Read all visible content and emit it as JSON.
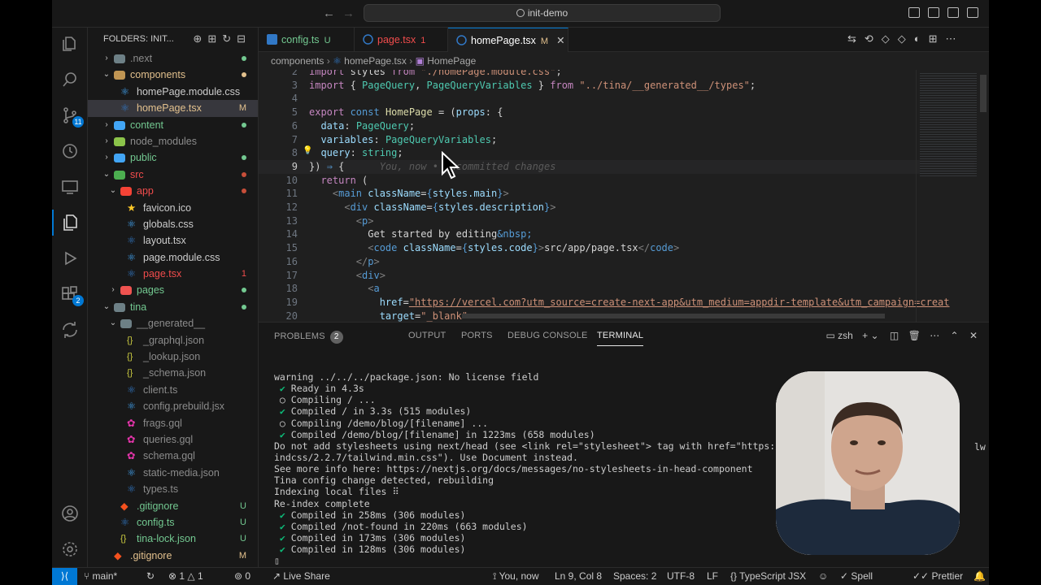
{
  "titlebar": {
    "search_text": "init-demo"
  },
  "sidebar": {
    "header": "FOLDERS: INIT...",
    "tree": [
      {
        "label": ".next",
        "depth": 1,
        "chev": "closed",
        "kind": "folder",
        "icon_color": "#6d8086",
        "label_color": "#8b8b8b",
        "status": "",
        "dot": "#73c991"
      },
      {
        "label": "components",
        "depth": 1,
        "chev": "open",
        "kind": "folder",
        "icon_color": "#c09553",
        "label_color": "#e2c08d",
        "status": "",
        "dot": "#e2c08d"
      },
      {
        "label": "homePage.module.css",
        "depth": 2,
        "chev": "",
        "kind": "file",
        "icon_color": "#42a5f5",
        "label_color": "#cccccc",
        "status": "",
        "dot": ""
      },
      {
        "label": "homePage.tsx",
        "depth": 2,
        "chev": "",
        "kind": "file",
        "icon_color": "#3178c6",
        "label_color": "#e2c08d",
        "status": "M",
        "dot": "",
        "selected": true
      },
      {
        "label": "content",
        "depth": 1,
        "chev": "closed",
        "kind": "folder",
        "icon_color": "#42a5f5",
        "label_color": "#73c991",
        "status": "",
        "dot": "#73c991"
      },
      {
        "label": "node_modules",
        "depth": 1,
        "chev": "closed",
        "kind": "folder",
        "icon_color": "#8bc34a",
        "label_color": "#8b8b8b",
        "status": "",
        "dot": ""
      },
      {
        "label": "public",
        "depth": 1,
        "chev": "closed",
        "kind": "folder",
        "icon_color": "#42a5f5",
        "label_color": "#73c991",
        "status": "",
        "dot": "#73c991"
      },
      {
        "label": "src",
        "depth": 1,
        "chev": "open",
        "kind": "folder",
        "icon_color": "#4caf50",
        "label_color": "#f14c4c",
        "status": "",
        "dot": "#c74e39"
      },
      {
        "label": "app",
        "depth": 2,
        "chev": "open",
        "kind": "folder",
        "icon_color": "#f44336",
        "label_color": "#f14c4c",
        "status": "",
        "dot": "#c74e39"
      },
      {
        "label": "favicon.ico",
        "depth": 3,
        "chev": "",
        "kind": "star",
        "icon_color": "#ffca28",
        "label_color": "#cccccc",
        "status": "",
        "dot": ""
      },
      {
        "label": "globals.css",
        "depth": 3,
        "chev": "",
        "kind": "file",
        "icon_color": "#42a5f5",
        "label_color": "#cccccc",
        "status": "",
        "dot": ""
      },
      {
        "label": "layout.tsx",
        "depth": 3,
        "chev": "",
        "kind": "file",
        "icon_color": "#3178c6",
        "label_color": "#cccccc",
        "status": "",
        "dot": ""
      },
      {
        "label": "page.module.css",
        "depth": 3,
        "chev": "",
        "kind": "file",
        "icon_color": "#42a5f5",
        "label_color": "#cccccc",
        "status": "",
        "dot": ""
      },
      {
        "label": "page.tsx",
        "depth": 3,
        "chev": "",
        "kind": "file",
        "icon_color": "#3178c6",
        "label_color": "#f14c4c",
        "status": "1",
        "dot": ""
      },
      {
        "label": "pages",
        "depth": 2,
        "chev": "closed",
        "kind": "folder",
        "icon_color": "#ef5350",
        "label_color": "#73c991",
        "status": "",
        "dot": "#73c991"
      },
      {
        "label": "tina",
        "depth": 1,
        "chev": "open",
        "kind": "folder",
        "icon_color": "#6d8086",
        "label_color": "#73c991",
        "status": "",
        "dot": "#73c991"
      },
      {
        "label": "__generated__",
        "depth": 2,
        "chev": "open",
        "kind": "folder",
        "icon_color": "#6d8086",
        "label_color": "#8b8b8b",
        "status": "",
        "dot": ""
      },
      {
        "label": "_graphql.json",
        "depth": 3,
        "chev": "",
        "kind": "json",
        "icon_color": "#cbcb41",
        "label_color": "#8b8b8b",
        "status": "",
        "dot": ""
      },
      {
        "label": "_lookup.json",
        "depth": 3,
        "chev": "",
        "kind": "json",
        "icon_color": "#cbcb41",
        "label_color": "#8b8b8b",
        "status": "",
        "dot": ""
      },
      {
        "label": "_schema.json",
        "depth": 3,
        "chev": "",
        "kind": "json",
        "icon_color": "#cbcb41",
        "label_color": "#8b8b8b",
        "status": "",
        "dot": ""
      },
      {
        "label": "client.ts",
        "depth": 3,
        "chev": "",
        "kind": "file",
        "icon_color": "#3178c6",
        "label_color": "#8b8b8b",
        "status": "",
        "dot": ""
      },
      {
        "label": "config.prebuild.jsx",
        "depth": 3,
        "chev": "",
        "kind": "file",
        "icon_color": "#42a5f5",
        "label_color": "#8b8b8b",
        "status": "",
        "dot": ""
      },
      {
        "label": "frags.gql",
        "depth": 3,
        "chev": "",
        "kind": "gql",
        "icon_color": "#e535ab",
        "label_color": "#8b8b8b",
        "status": "",
        "dot": ""
      },
      {
        "label": "queries.gql",
        "depth": 3,
        "chev": "",
        "kind": "gql",
        "icon_color": "#e535ab",
        "label_color": "#8b8b8b",
        "status": "",
        "dot": ""
      },
      {
        "label": "schema.gql",
        "depth": 3,
        "chev": "",
        "kind": "gql",
        "icon_color": "#e535ab",
        "label_color": "#8b8b8b",
        "status": "",
        "dot": ""
      },
      {
        "label": "static-media.json",
        "depth": 3,
        "chev": "",
        "kind": "file",
        "icon_color": "#42a5f5",
        "label_color": "#8b8b8b",
        "status": "",
        "dot": ""
      },
      {
        "label": "types.ts",
        "depth": 3,
        "chev": "",
        "kind": "file",
        "icon_color": "#3178c6",
        "label_color": "#8b8b8b",
        "status": "",
        "dot": ""
      },
      {
        "label": ".gitignore",
        "depth": 2,
        "chev": "",
        "kind": "git",
        "icon_color": "#f4511e",
        "label_color": "#73c991",
        "status": "U",
        "dot": ""
      },
      {
        "label": "config.ts",
        "depth": 2,
        "chev": "",
        "kind": "file",
        "icon_color": "#3178c6",
        "label_color": "#73c991",
        "status": "U",
        "dot": ""
      },
      {
        "label": "tina-lock.json",
        "depth": 2,
        "chev": "",
        "kind": "json",
        "icon_color": "#cbcb41",
        "label_color": "#73c991",
        "status": "U",
        "dot": ""
      },
      {
        "label": ".gitignore",
        "depth": 1,
        "chev": "",
        "kind": "git",
        "icon_color": "#f4511e",
        "label_color": "#e2c08d",
        "status": "M",
        "dot": ""
      }
    ]
  },
  "activity": {
    "source_control_badge": "11",
    "extensions_badge": "2"
  },
  "tabs": [
    {
      "label": "config.ts",
      "status": "U",
      "label_color": "#73c991",
      "status_color": "#73c991",
      "active": false
    },
    {
      "label": "page.tsx",
      "status": "1",
      "label_color": "#f14c4c",
      "status_color": "#f14c4c",
      "active": false
    },
    {
      "label": "homePage.tsx",
      "status": "M",
      "label_color": "#ffffff",
      "status_color": "#e2c08d",
      "active": true
    }
  ],
  "breadcrumb": {
    "folder": "components",
    "file": "homePage.tsx",
    "symbol": "HomePage"
  },
  "editor": {
    "lines": [
      {
        "n": "2",
        "t": [
          [
            "kw2",
            "import "
          ],
          [
            "pn",
            "styles "
          ],
          [
            "kw2",
            "from "
          ],
          [
            "str",
            "\"./homePage.module.css\""
          ],
          [
            "pn",
            ";"
          ]
        ]
      },
      {
        "n": "3",
        "t": [
          [
            "kw2",
            "import "
          ],
          [
            "pn",
            "{ "
          ],
          [
            "ty",
            "PageQuery"
          ],
          [
            "pn",
            ", "
          ],
          [
            "ty",
            "PageQueryVariables"
          ],
          [
            "pn",
            " } "
          ],
          [
            "kw2",
            "from "
          ],
          [
            "str",
            "\"../tina/__generated__/types\""
          ],
          [
            "pn",
            ";"
          ]
        ]
      },
      {
        "n": "4",
        "t": []
      },
      {
        "n": "5",
        "t": [
          [
            "kw2",
            "export "
          ],
          [
            "kw",
            "const "
          ],
          [
            "fn",
            "HomePage"
          ],
          [
            "pn",
            " = ("
          ],
          [
            "id",
            "props"
          ],
          [
            "pn",
            ": {"
          ]
        ]
      },
      {
        "n": "6",
        "t": [
          [
            "id",
            "  data"
          ],
          [
            "pn",
            ": "
          ],
          [
            "ty",
            "PageQuery"
          ],
          [
            "pn",
            ";"
          ]
        ]
      },
      {
        "n": "7",
        "t": [
          [
            "id",
            "  variables"
          ],
          [
            "pn",
            ": "
          ],
          [
            "ty",
            "PageQueryVariables"
          ],
          [
            "pn",
            ";"
          ]
        ]
      },
      {
        "n": "8",
        "t": [
          [
            "id",
            "  query"
          ],
          [
            "pn",
            ": "
          ],
          [
            "ty",
            "string"
          ],
          [
            "pn",
            ";"
          ]
        ]
      },
      {
        "n": "9",
        "t": [
          [
            "pn",
            "}) "
          ],
          [
            "kw",
            "⇒ "
          ],
          [
            "pn",
            "{"
          ],
          [
            "ghost",
            "      You, now • Uncommitted changes"
          ]
        ],
        "current": true
      },
      {
        "n": "10",
        "t": [
          [
            "kw2",
            "  return "
          ],
          [
            "pn",
            "("
          ]
        ]
      },
      {
        "n": "11",
        "t": [
          [
            "tgn",
            "    <"
          ],
          [
            "tg",
            "main "
          ],
          [
            "id",
            "className"
          ],
          [
            "pn",
            "="
          ],
          [
            "kw",
            "{"
          ],
          [
            "id",
            "styles.main"
          ],
          [
            "kw",
            "}"
          ],
          [
            "tgn",
            ">"
          ]
        ]
      },
      {
        "n": "12",
        "t": [
          [
            "tgn",
            "      <"
          ],
          [
            "tg",
            "div "
          ],
          [
            "id",
            "className"
          ],
          [
            "pn",
            "="
          ],
          [
            "kw",
            "{"
          ],
          [
            "id",
            "styles.description"
          ],
          [
            "kw",
            "}"
          ],
          [
            "tgn",
            ">"
          ]
        ]
      },
      {
        "n": "13",
        "t": [
          [
            "tgn",
            "        <"
          ],
          [
            "tg",
            "p"
          ],
          [
            "tgn",
            ">"
          ]
        ]
      },
      {
        "n": "14",
        "t": [
          [
            "pn",
            "          Get started by editing"
          ],
          [
            "ent",
            "&nbsp;"
          ]
        ]
      },
      {
        "n": "15",
        "t": [
          [
            "tgn",
            "          <"
          ],
          [
            "tg",
            "code "
          ],
          [
            "id",
            "className"
          ],
          [
            "pn",
            "="
          ],
          [
            "kw",
            "{"
          ],
          [
            "id",
            "styles.code"
          ],
          [
            "kw",
            "}"
          ],
          [
            "tgn",
            ">"
          ],
          [
            "pn",
            "src/app/page.tsx"
          ],
          [
            "tgn",
            "</"
          ],
          [
            "tg",
            "code"
          ],
          [
            "tgn",
            ">"
          ]
        ]
      },
      {
        "n": "16",
        "t": [
          [
            "tgn",
            "        </"
          ],
          [
            "tg",
            "p"
          ],
          [
            "tgn",
            ">"
          ]
        ]
      },
      {
        "n": "17",
        "t": [
          [
            "tgn",
            "        <"
          ],
          [
            "tg",
            "div"
          ],
          [
            "tgn",
            ">"
          ]
        ]
      },
      {
        "n": "18",
        "t": [
          [
            "tgn",
            "          <"
          ],
          [
            "tg",
            "a"
          ]
        ]
      },
      {
        "n": "19",
        "t": [
          [
            "id",
            "            href"
          ],
          [
            "pn",
            "="
          ],
          [
            "str",
            "\"https://vercel.com?utm_source=create-next-app&utm_medium=appdir-template&utm_campaign=creat"
          ]
        ]
      },
      {
        "n": "20",
        "t": [
          [
            "id",
            "            target"
          ],
          [
            "pn",
            "="
          ],
          [
            "str",
            "\"_blank\""
          ]
        ]
      }
    ]
  },
  "panel": {
    "tabs": [
      "PROBLEMS",
      "OUTPUT",
      "PORTS",
      "DEBUG CONSOLE",
      "TERMINAL"
    ],
    "problems_count": "2",
    "active_tab": "TERMINAL",
    "shell_label": "zsh",
    "terminal_lines": [
      [
        "",
        "warning ../../../package.json: No license field"
      ],
      [
        "ok",
        " ✔ Ready in 4.3s"
      ],
      [
        "sp",
        " ○ Compiling / ..."
      ],
      [
        "ok",
        " ✔ Compiled / in 3.3s (515 modules)"
      ],
      [
        "sp",
        " ○ Compiling /demo/blog/[filename] ..."
      ],
      [
        "ok",
        " ✔ Compiled /demo/blog/[filename] in 1223ms (658 modules)"
      ],
      [
        "",
        "Do not add stylesheets using next/head (see <link rel=\"stylesheet\"> tag with href=\"https://"
      ],
      [
        "",
        "indcss/2.2.7/tailwind.min.css\"). Use Document instead."
      ],
      [
        "",
        "See more info here: https://nextjs.org/docs/messages/no-stylesheets-in-head-component"
      ],
      [
        "",
        "Tina config change detected, rebuilding"
      ],
      [
        "",
        "Indexing local files ⠿"
      ],
      [
        "",
        "Re-index complete"
      ],
      [
        "ok",
        " ✔ Compiled in 258ms (306 modules)"
      ],
      [
        "ok",
        " ✔ Compiled /not-found in 220ms (663 modules)"
      ],
      [
        "ok",
        " ✔ Compiled in 173ms (306 modules)"
      ],
      [
        "ok",
        " ✔ Compiled in 128ms (306 modules)"
      ],
      [
        "",
        "▯"
      ]
    ],
    "overflow_text": "lw"
  },
  "status": {
    "branch": "main*",
    "errors": "1",
    "warnings": "1",
    "ports": "0",
    "live_share": "Live Share",
    "blame": "You, now",
    "cursor": "Ln 9, Col 8",
    "spaces": "Spaces: 2",
    "encoding": "UTF-8",
    "eol": "LF",
    "language": "TypeScript JSX",
    "spell": "Spell",
    "prettier": "Prettier"
  }
}
